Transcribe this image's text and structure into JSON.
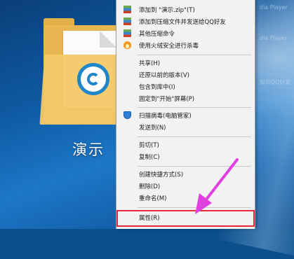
{
  "desktop": {
    "folder_label": "演示",
    "bg_texts": [
      "dia Player",
      "dia Player",
      "加到QQ好友"
    ]
  },
  "context_menu": {
    "items": [
      {
        "label": "添加到 \"演示.zip\"(T)",
        "icon": "zip-icon"
      },
      {
        "label": "添加到压缩文件并发送给QQ好友",
        "icon": "zip-icon"
      },
      {
        "label": "其他压缩命令",
        "icon": "zip-icon"
      },
      {
        "label": "使用火绒安全进行杀毒",
        "icon": "fire-icon"
      },
      {
        "label": "共享(H)"
      },
      {
        "label": "还原以前的版本(V)"
      },
      {
        "label": "包含到库中(I)"
      },
      {
        "label": "固定到\"开始\"屏幕(P)"
      },
      {
        "label": "扫描病毒(电脑管家)",
        "icon": "shield-icon"
      },
      {
        "label": "发送到(N)"
      },
      {
        "label": "剪切(T)"
      },
      {
        "label": "复制(C)"
      },
      {
        "label": "创建快捷方式(S)"
      },
      {
        "label": "删除(D)"
      },
      {
        "label": "重命名(M)"
      },
      {
        "label": "属性(R)"
      }
    ]
  },
  "colors": {
    "highlight": "#e8283a",
    "arrow": "#e040e0"
  }
}
